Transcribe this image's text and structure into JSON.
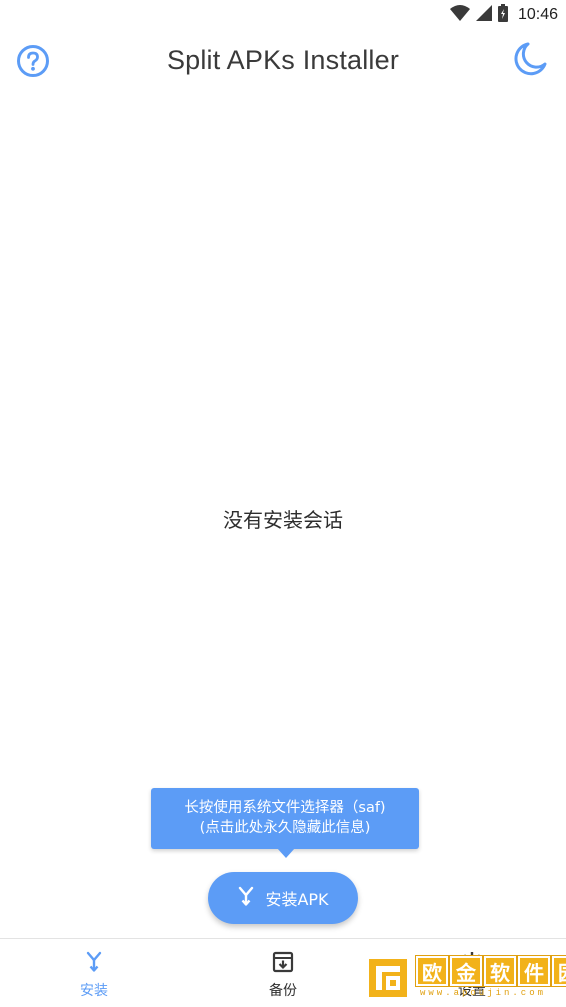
{
  "status_bar": {
    "time": "10:46",
    "icons": [
      "wifi-icon",
      "cell-signal-icon",
      "battery-icon"
    ]
  },
  "app_bar": {
    "title": "Split APKs Installer",
    "left_icon": "help-circle-icon",
    "right_icon": "moon-icon"
  },
  "main": {
    "empty_message": "没有安装会话"
  },
  "tooltip": {
    "line1": "长按使用系统文件选择器（saf)",
    "line2": "(点击此处永久隐藏此信息)"
  },
  "fab": {
    "label": "安装APK",
    "icon": "merge-arrow-icon"
  },
  "bottom_nav": {
    "items": [
      {
        "label": "安装",
        "icon": "merge-arrow-icon",
        "active": true
      },
      {
        "label": "备份",
        "icon": "archive-box-icon",
        "active": false
      },
      {
        "label": "设置",
        "icon": "gear-icon",
        "active": false
      }
    ]
  },
  "watermark": {
    "chars": [
      "欧",
      "金",
      "软",
      "件",
      "园"
    ],
    "url": "www.apoujin.com"
  },
  "colors": {
    "accent": "#5c9cf6",
    "text": "#333333",
    "background": "#ffffff",
    "watermark": "#f2b21a"
  }
}
